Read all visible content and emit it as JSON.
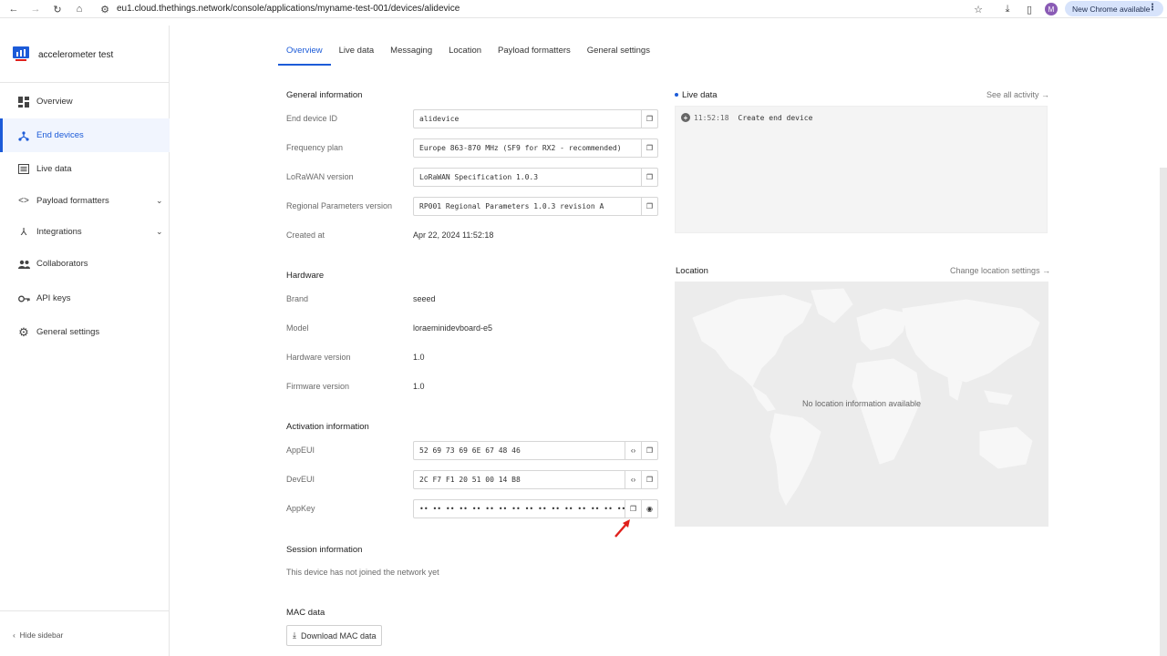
{
  "browser": {
    "url": "eu1.cloud.thethings.network/console/applications/myname-test-001/devices/alidevice",
    "avatar_letter": "M",
    "chrome_update": "New Chrome available"
  },
  "sidebar": {
    "app_name": "accelerometer test",
    "items": [
      {
        "label": "Overview"
      },
      {
        "label": "End devices"
      },
      {
        "label": "Live data"
      },
      {
        "label": "Payload formatters"
      },
      {
        "label": "Integrations"
      },
      {
        "label": "Collaborators"
      },
      {
        "label": "API keys"
      },
      {
        "label": "General settings"
      }
    ],
    "hide_label": "Hide sidebar"
  },
  "tabs": [
    "Overview",
    "Live data",
    "Messaging",
    "Location",
    "Payload formatters",
    "General settings"
  ],
  "general": {
    "title": "General information",
    "end_device_id_label": "End device ID",
    "end_device_id": "alidevice",
    "frequency_plan_label": "Frequency plan",
    "frequency_plan": "Europe 863-870 MHz (SF9 for RX2 - recommended)",
    "lorawan_version_label": "LoRaWAN version",
    "lorawan_version": "LoRaWAN Specification 1.0.3",
    "regional_label": "Regional Parameters version",
    "regional": "RP001 Regional Parameters 1.0.3 revision A",
    "created_label": "Created at",
    "created": "Apr 22, 2024 11:52:18"
  },
  "hardware": {
    "title": "Hardware",
    "brand_label": "Brand",
    "brand": "seeed",
    "model_label": "Model",
    "model": "loraeminidevboard-e5",
    "hw_version_label": "Hardware version",
    "hw_version": "1.0",
    "fw_version_label": "Firmware version",
    "fw_version": "1.0"
  },
  "activation": {
    "title": "Activation information",
    "appeui_label": "AppEUI",
    "appeui": "52 69 73 69 6E 67 48 46",
    "deveui_label": "DevEUI",
    "deveui": "2C F7 F1 20 51 00 14 B8",
    "appkey_label": "AppKey",
    "appkey": "•• •• •• •• •• •• •• •• •• •• •• •• •• •• •• ••"
  },
  "session": {
    "title": "Session information",
    "text": "This device has not joined the network yet"
  },
  "mac": {
    "title": "MAC data",
    "download_label": "Download MAC data"
  },
  "live": {
    "title": "Live data",
    "see_all": "See all activity →",
    "entry_time": "11:52:18",
    "entry_msg": "Create end device"
  },
  "location": {
    "title": "Location",
    "change": "Change location settings →",
    "empty": "No location information available"
  },
  "colors": {
    "accent": "#1c5bd8",
    "annotation_arrow": "#e0201b"
  }
}
